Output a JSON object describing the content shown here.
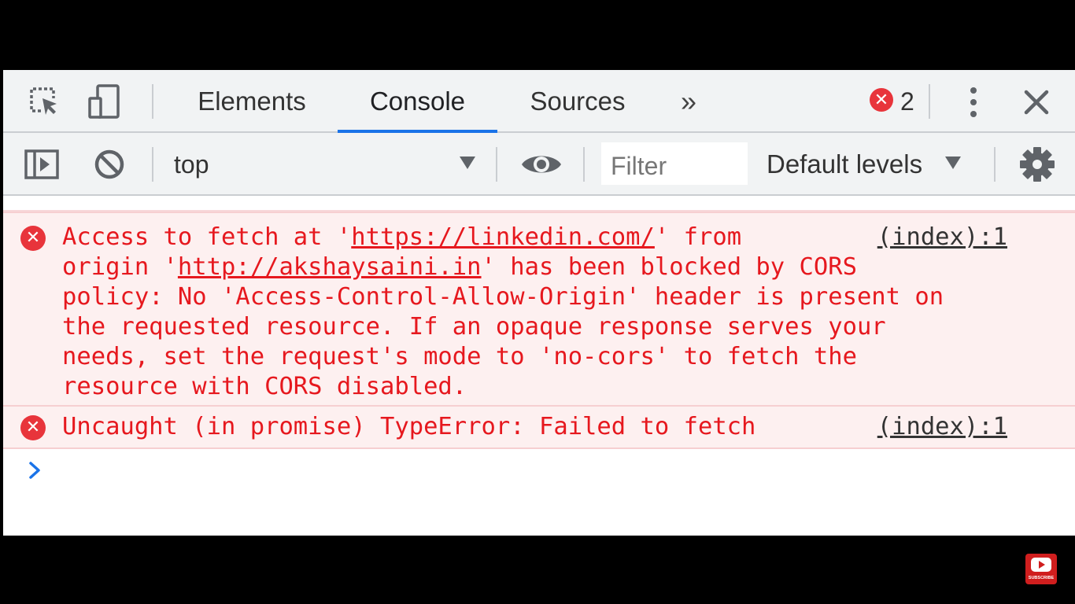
{
  "tabs": {
    "elements": "Elements",
    "console": "Console",
    "sources": "Sources",
    "more": "»"
  },
  "error_count": "2",
  "toolbar": {
    "context": "top",
    "filter_placeholder": "Filter",
    "levels": "Default levels"
  },
  "messages": [
    {
      "line1_a": "Access to fetch at '",
      "line1_url": "https://linkedin.com/",
      "line1_b": "' from",
      "line2_a": "origin '",
      "line2_url": "http://akshaysaini.in",
      "line2_b": "' has been blocked by CORS",
      "line3": "policy: No 'Access-Control-Allow-Origin' header is present on",
      "line4": "the requested resource. If an opaque response serves your",
      "line5": "needs, set the request's mode to 'no-cors' to fetch the",
      "line6": "resource with CORS disabled.",
      "source": "(index):1"
    },
    {
      "text": "Uncaught (in promise) TypeError: Failed to fetch",
      "source": "(index):1"
    }
  ],
  "subscribe_label": "SUBSCRIBE",
  "colors": {
    "error_red": "#e6181e",
    "error_bg": "#fdf0f0",
    "accent_blue": "#1a73e8"
  }
}
